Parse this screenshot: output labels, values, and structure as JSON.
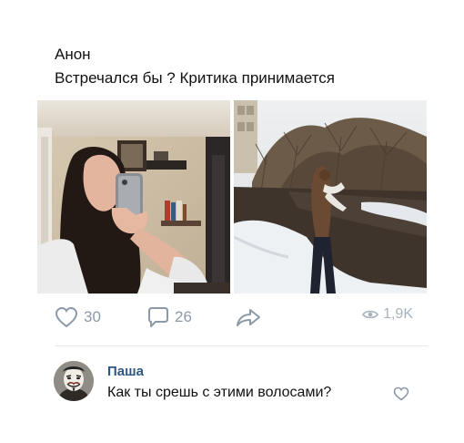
{
  "post": {
    "author": "Анон",
    "text": "Встречался бы ? Критика принимается",
    "photos": [
      {
        "subject": "mirror selfie"
      },
      {
        "subject": "girl in snowy park"
      }
    ]
  },
  "actions": {
    "likes": "30",
    "comments": "26",
    "views": "1,9K",
    "icons": {
      "like": "heart-icon",
      "comment": "comment-bubble-icon",
      "share": "share-arrow-icon",
      "views": "eye-icon"
    }
  },
  "comment": {
    "author": "Паша",
    "text": "Как ты срешь с этими волосами?",
    "avatar": "guy-fawkes-mask-avatar",
    "like_icon": "heart-icon"
  },
  "colors": {
    "icon_gray": "#8c9aa8",
    "link_blue": "#2a5885"
  }
}
